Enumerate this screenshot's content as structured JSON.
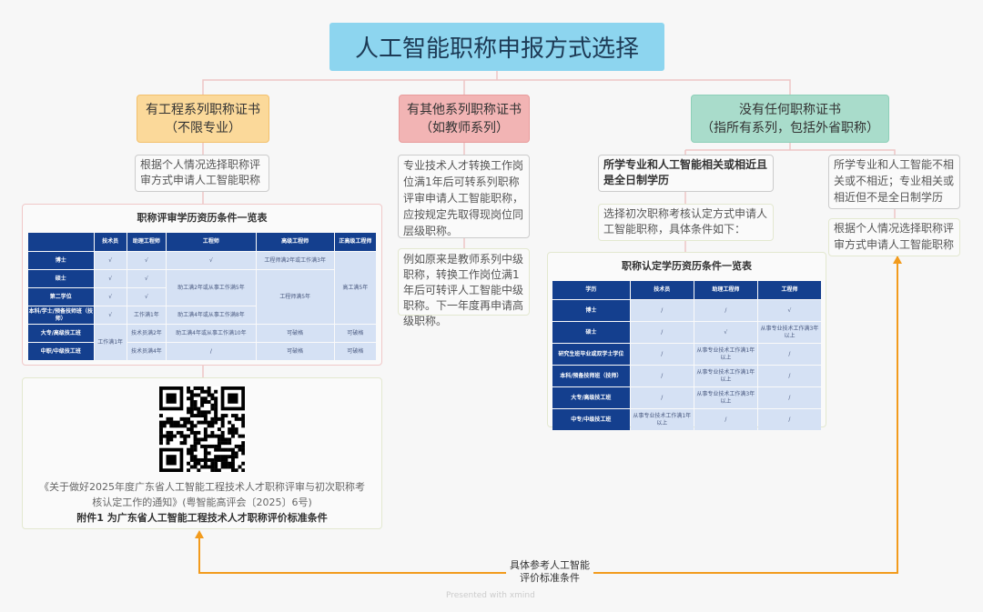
{
  "title": "人工智能职称申报方式选择",
  "branches": [
    {
      "title": "有工程系列职称证书",
      "subtitle": "（不限专业）",
      "color": "#fbd99a",
      "note": "根据个人情况选择职称评审方式申请人工智能职称"
    },
    {
      "title": "有其他系列职称证书",
      "subtitle": "（如教师系列）",
      "color": "#f2b4b4",
      "note1": "专业技术人才转换工作岗位满1年后可转系列职称评审申请人工智能职称，应按规定先取得现岗位同层级职称。",
      "note2": "例如原来是教师系列中级职称，转换工作岗位满1年后可转评人工智能中级职称。下一年度再申请高级职称。"
    },
    {
      "title": "没有任何职称证书",
      "subtitle": "（指所有系列，包括外省职称）",
      "color": "#a9dccb",
      "left_cond": "所学专业和人工智能相关或相近且是全日制学历",
      "left_note": "选择初次职称考核认定方式申请人工智能职称，具体条件如下：",
      "right_cond": "所学专业和人工智能不相关或不相近；专业相关或相近但不是全日制学历",
      "right_note": "根据个人情况选择职称评审方式申请人工智能职称"
    }
  ],
  "table1": {
    "title": "职称评审学历资历条件一览表",
    "headers": [
      "",
      "技术员",
      "助理工程师",
      "工程师",
      "高级工程师",
      "正高级工程师"
    ],
    "rows": [
      "博士",
      "硕士",
      "第二学位",
      "本科/学士/预备技师班（技师）",
      "大专/高级技工班",
      "中职/中级技工班"
    ],
    "check": "√",
    "c_eng_boshi": "工程师满2年或工作满3年",
    "c_zhenggao": "高工满5年",
    "c_eng_shuoshi": "助工满2年或从事工作满5年",
    "c_gaoji": "工程师满5年",
    "c_bk_assist": "工作满1年",
    "c_bk_eng": "助工满4年或从事工作满8年",
    "c_tech_low": "工作满1年",
    "c_dz_assist": "技术员满2年",
    "c_dz_eng": "助工满4年或从事工作满10年",
    "c_zz_assist": "技术员满4年",
    "slash": "/",
    "pogé": "可破格"
  },
  "table2": {
    "title": "职称认定学历资历条件一览表",
    "headers": [
      "学历",
      "技术员",
      "助理工程师",
      "工程师"
    ],
    "rows": [
      [
        "博士",
        "/",
        "/",
        "√"
      ],
      [
        "硕士",
        "/",
        "√",
        "从事专业技术工作满3年以上"
      ],
      [
        "研究生班毕业或双学士学位",
        "/",
        "从事专业技术工作满1年以上",
        "/"
      ],
      [
        "本科/预备技师班（技师）",
        "/",
        "从事专业技术工作满1年以上",
        "/"
      ],
      [
        "大专/高级技工班",
        "/",
        "从事专业技术工作满3年以上",
        "/"
      ],
      [
        "中专/中级技工班",
        "从事专业技术工作满1年以上",
        "/",
        "/"
      ]
    ]
  },
  "doc": {
    "line1": "《关于做好2025年度广东省人工智能工程技术人才职称评审与初次职称考核认定工作的通知》(粤智能高评会〔2025〕6号)",
    "line2": "附件1 为广东省人工智能工程技术人才职称评价标准条件"
  },
  "arrow_label": "具体参考人工智能评价标准条件",
  "footer": "Presented with xmind",
  "colors": {
    "arrow": "#f29b1d",
    "connector": "#f0c4c4",
    "header": "#143f8e"
  }
}
